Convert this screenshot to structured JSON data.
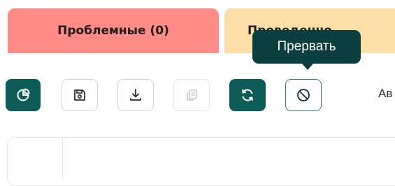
{
  "tabs": {
    "problem_label": "Проблемные (0)",
    "second_label": "Проведенно"
  },
  "toolbar": {
    "buttons": [
      {
        "icon": "pie-chart-icon",
        "style": "filled"
      },
      {
        "icon": "save-icon",
        "style": "outline"
      },
      {
        "icon": "download-icon",
        "style": "outline"
      },
      {
        "icon": "copy-icon",
        "style": "disabled"
      },
      {
        "icon": "refresh-icon",
        "style": "filled"
      },
      {
        "icon": "cancel-icon",
        "style": "outline-accent"
      }
    ],
    "trailing_text": "Ав"
  },
  "tooltip": {
    "text": "Прервать"
  },
  "colors": {
    "problem_tab": "#ff8b86",
    "second_tab": "#fbdfa6",
    "primary": "#0e5c58",
    "tooltip_bg": "#0b3e3f"
  }
}
